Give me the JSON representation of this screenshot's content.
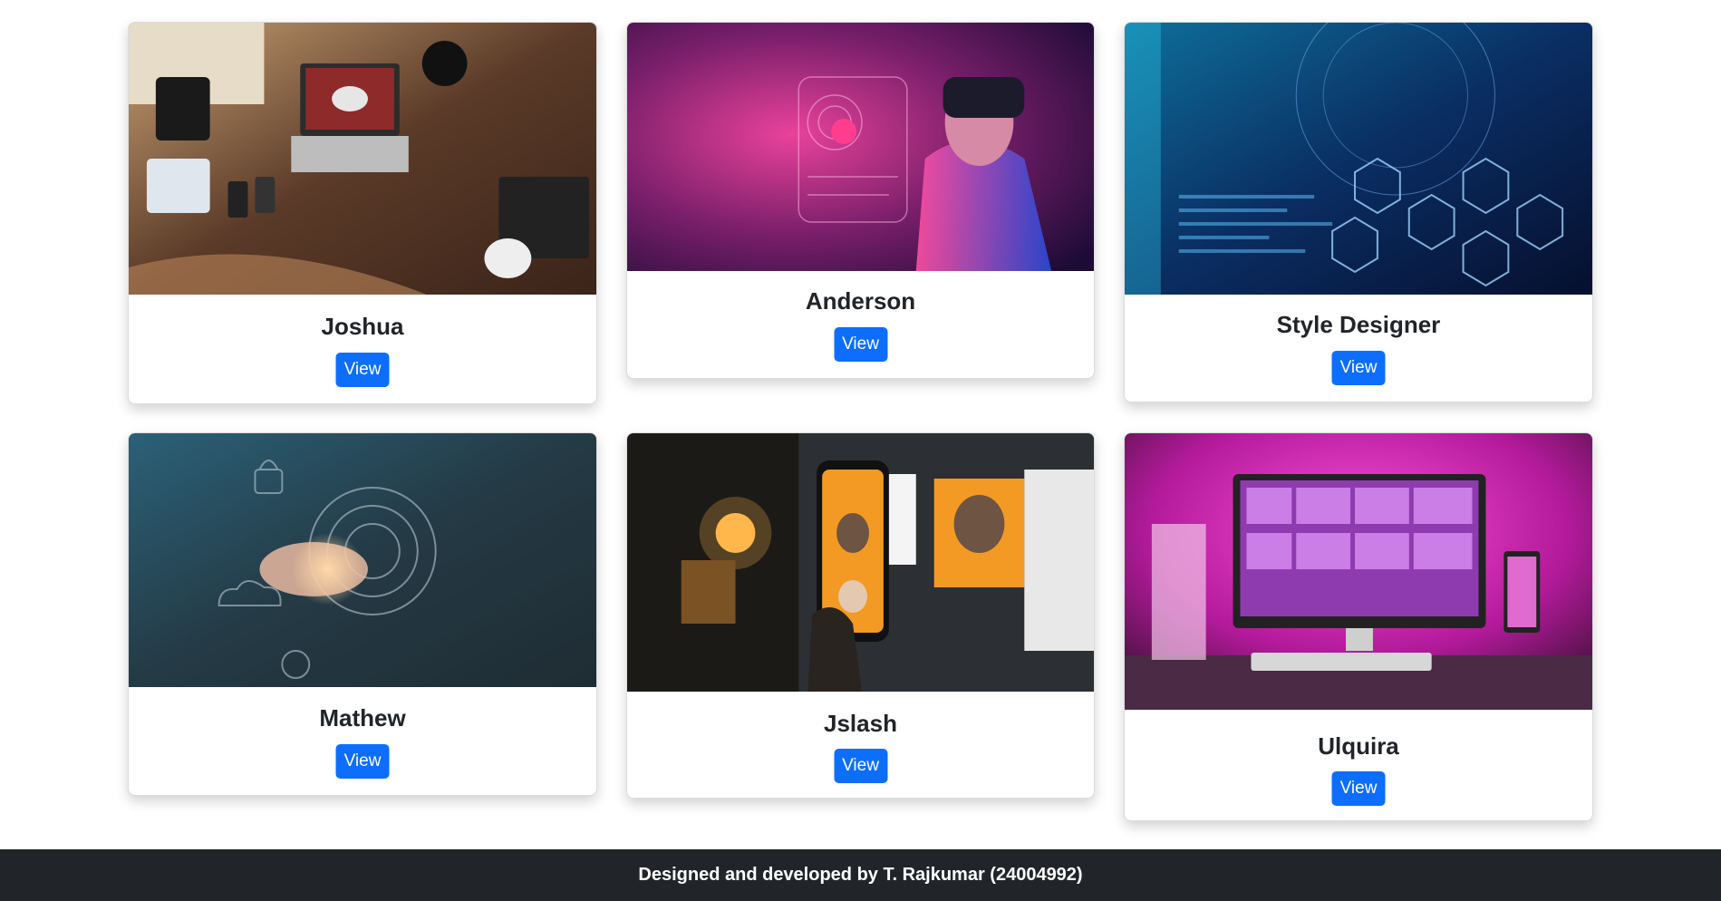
{
  "cards": [
    {
      "title": "Joshua",
      "button": "View"
    },
    {
      "title": "Anderson",
      "button": "View"
    },
    {
      "title": "Style Designer",
      "button": "View"
    },
    {
      "title": "Mathew",
      "button": "View"
    },
    {
      "title": "Jslash",
      "button": "View"
    },
    {
      "title": "Ulquira",
      "button": "View"
    }
  ],
  "footer": {
    "text": "Designed and developed by T. Rajkumar (24004992)"
  }
}
